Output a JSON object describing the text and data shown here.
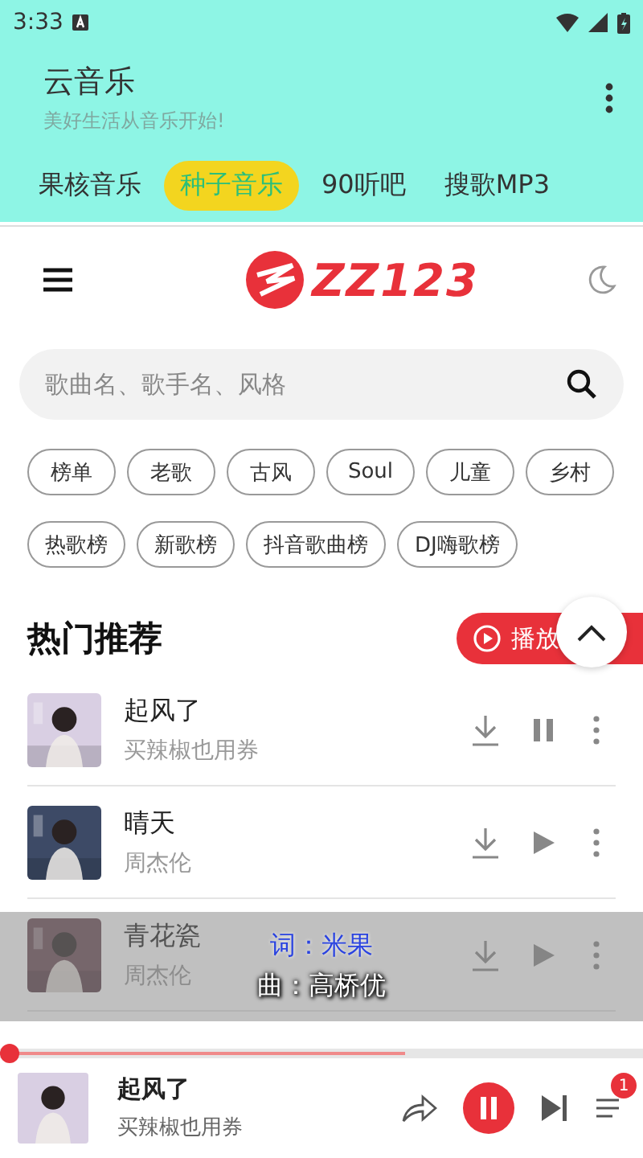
{
  "status_bar": {
    "time": "3:33"
  },
  "app_bar": {
    "title": "云音乐",
    "subtitle": "美好生活从音乐开始!"
  },
  "tabs": [
    {
      "label": "果核音乐",
      "selected": false
    },
    {
      "label": "种子音乐",
      "selected": true
    },
    {
      "label": "90听吧",
      "selected": false
    },
    {
      "label": "搜歌MP3",
      "selected": false
    }
  ],
  "site_header": {
    "logo": "ZZ123"
  },
  "search": {
    "placeholder": "歌曲名、歌手名、风格"
  },
  "tag_rows": [
    [
      "榜单",
      "老歌",
      "古风",
      "Soul",
      "儿童",
      "乡村"
    ],
    [
      "热歌榜",
      "新歌榜",
      "抖音歌曲榜",
      "DJ嗨歌榜"
    ]
  ],
  "section": {
    "title": "热门推荐",
    "play_all": "播放"
  },
  "songs": [
    {
      "title": "起风了",
      "artist": "买辣椒也用券",
      "playing": true
    },
    {
      "title": "晴天",
      "artist": "周杰伦",
      "playing": false
    },
    {
      "title": "青花瓷",
      "artist": "周杰伦",
      "playing": false
    }
  ],
  "lyrics": [
    {
      "text": "词：米果",
      "highlighted": true
    },
    {
      "text": "曲：高桥优",
      "highlighted": false
    }
  ],
  "progress": {
    "level": 0.63
  },
  "now_playing": {
    "title": "起风了",
    "artist": "买辣椒也用券",
    "playing": true,
    "queue_count": "1"
  }
}
